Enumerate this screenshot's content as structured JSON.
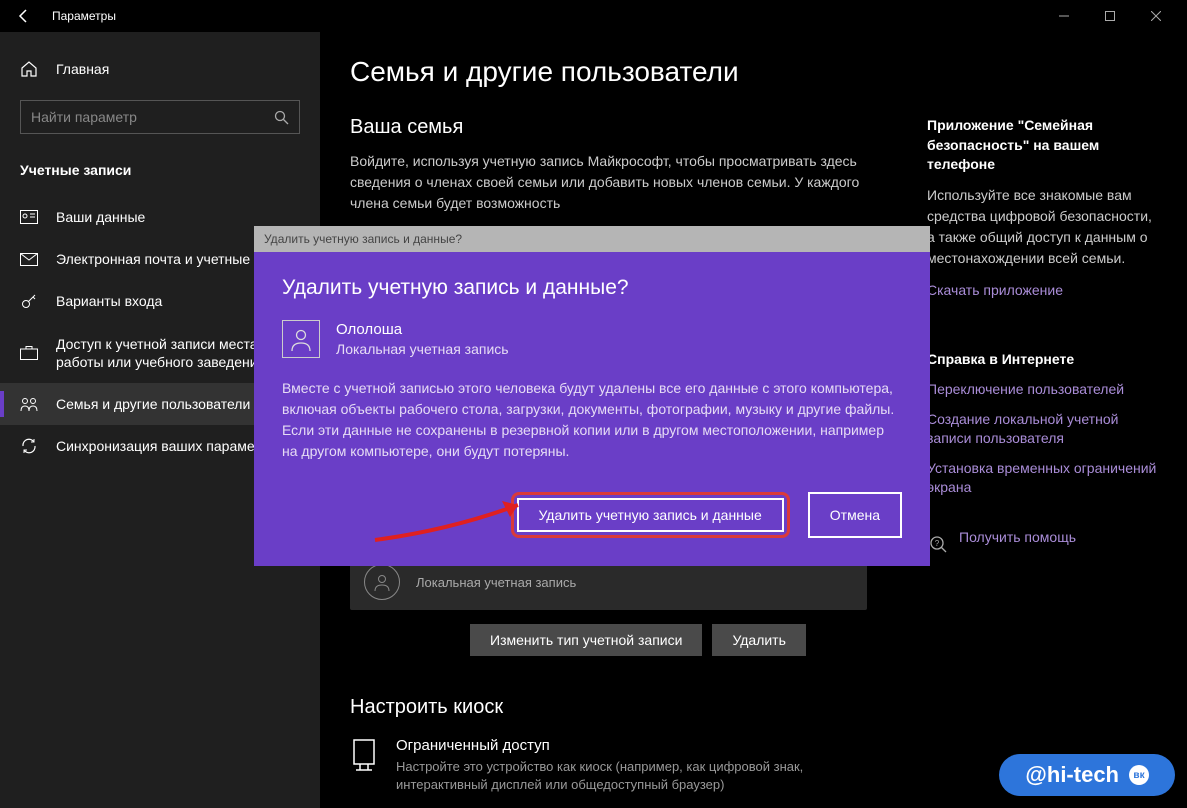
{
  "titlebar": {
    "back": "←",
    "title": "Параметры"
  },
  "sidebar": {
    "home": "Главная",
    "search_placeholder": "Найти параметр",
    "section": "Учетные записи",
    "items": [
      {
        "label": "Ваши данные"
      },
      {
        "label": "Электронная почта и учетные записи"
      },
      {
        "label": "Варианты входа"
      },
      {
        "label": "Доступ к учетной записи места работы или учебного заведения"
      },
      {
        "label": "Семья и другие пользователи"
      },
      {
        "label": "Синхронизация ваших параметров"
      }
    ]
  },
  "main": {
    "heading": "Семья и другие пользователи",
    "fam_title": "Ваша семья",
    "fam_desc": "Войдите, используя учетную запись Майкрософт, чтобы просматривать здесь сведения о членах своей семьи или добавить новых членов семьи. У каждого члена семьи будет возможность",
    "user_type": "Локальная учетная запись",
    "btn_change": "Изменить тип учетной записи",
    "btn_delete": "Удалить",
    "kiosk_title": "Настроить киоск",
    "kiosk_heading": "Ограниченный доступ",
    "kiosk_sub": "Настройте это устройство как киоск (например, как цифровой знак, интерактивный дисплей или общедоступный браузер)"
  },
  "right": {
    "family_title": "Приложение \"Семейная безопасность\" на вашем телефоне",
    "family_desc": "Используйте все знакомые вам средства цифровой безопасности, а также общий доступ к данным о местонахождении всей семьи.",
    "download_link": "Скачать приложение",
    "help_title": "Справка в Интернете",
    "links": [
      "Переключение пользователей",
      "Создание локальной учетной записи пользователя",
      "Установка временных ограничений экрана"
    ],
    "get_help": "Получить помощь"
  },
  "modal": {
    "titlebar": "Удалить учетную запись и данные?",
    "heading": "Удалить учетную запись и данные?",
    "user_name": "Ололоша",
    "user_type": "Локальная учетная запись",
    "warning": "Вместе с учетной записью этого человека будут удалены все его данные с этого компьютера, включая объекты рабочего стола, загрузки, документы, фотографии, музыку и другие файлы. Если эти данные не сохранены в резервной копии или в другом местоположении, например на другом компьютере, они будут потеряны.",
    "btn_delete": "Удалить учетную запись и данные",
    "btn_cancel": "Отмена"
  },
  "watermark": {
    "text": "@hi-tech",
    "badge": "вк"
  }
}
